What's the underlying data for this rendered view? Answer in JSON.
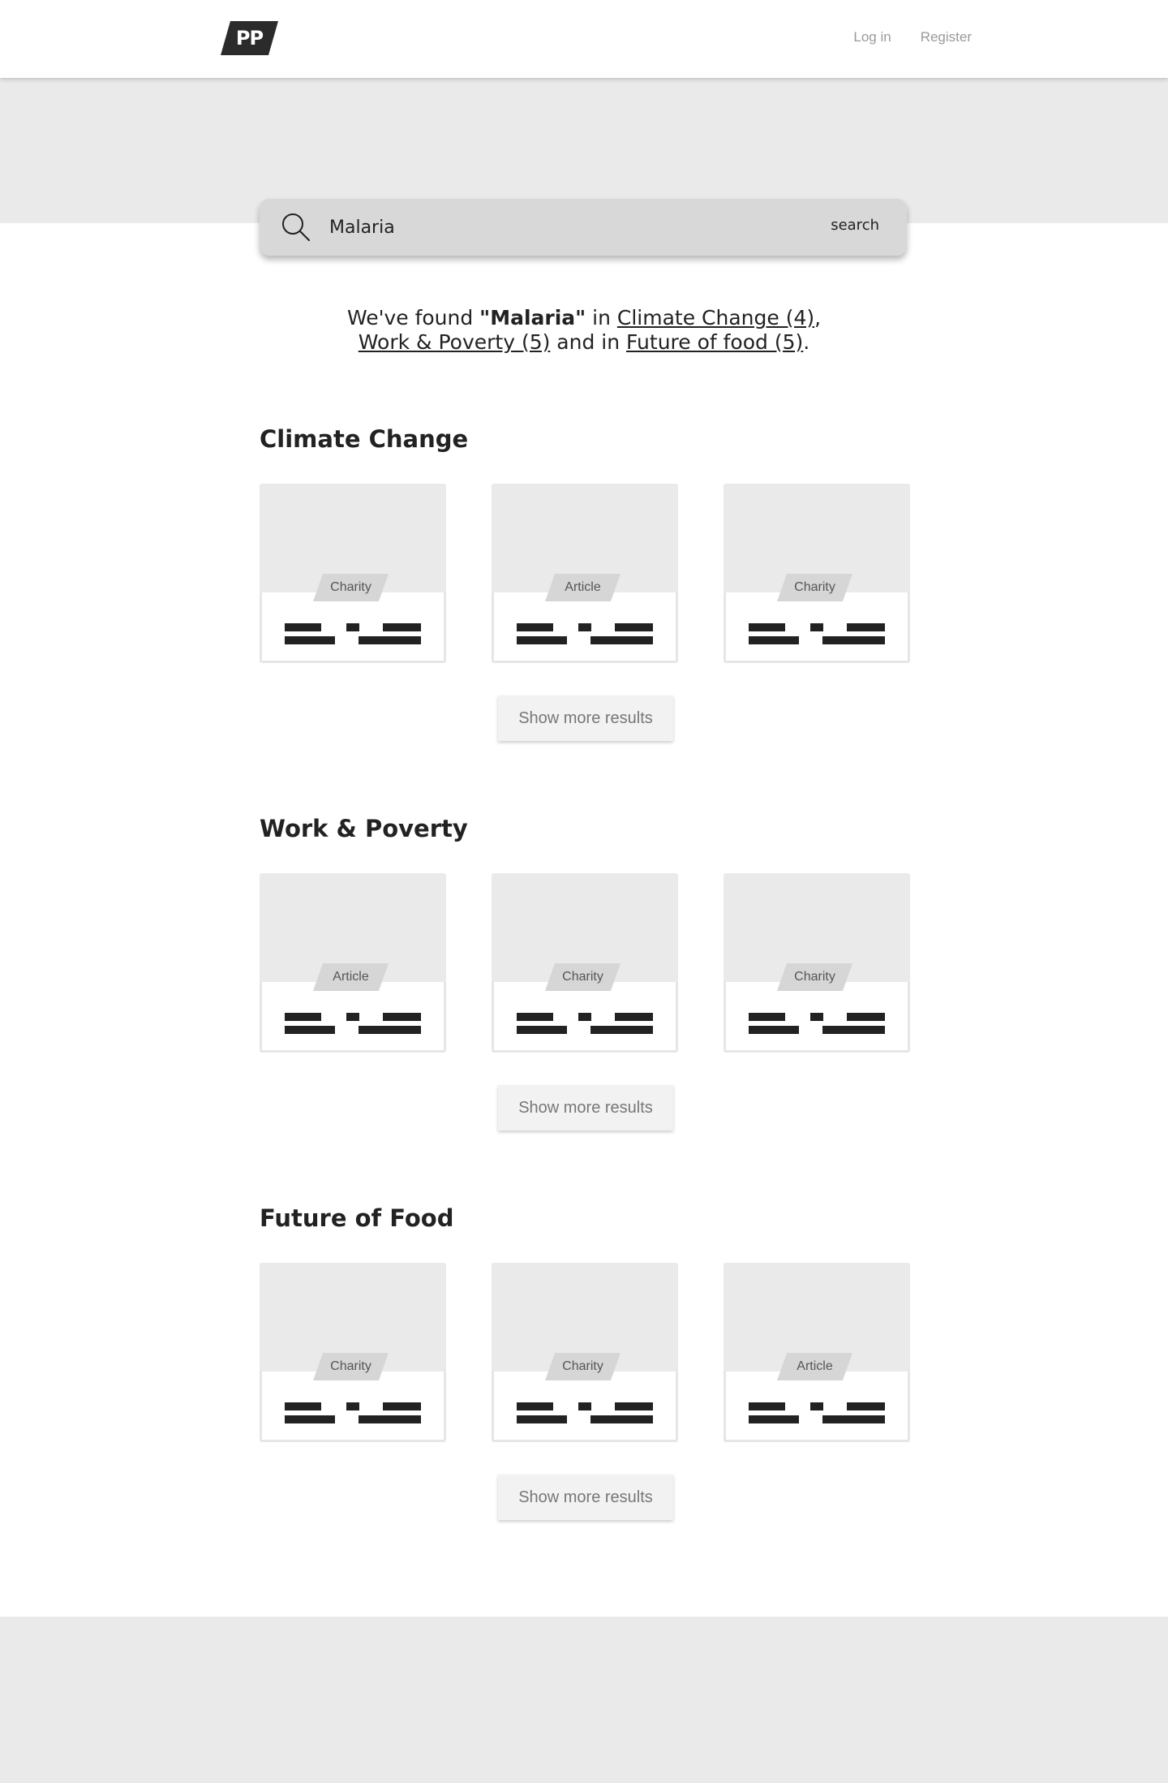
{
  "header": {
    "logo_text": "PP",
    "nav": {
      "login": "Log in",
      "register": "Register"
    }
  },
  "search": {
    "value": "Malaria",
    "button_label": "search"
  },
  "summary": {
    "prefix": "We've found ",
    "query": "\"Malaria\"",
    "in1": " in ",
    "link1": "Climate Change (4)",
    "sep": ",",
    "link2": "Work & Poverty (5)",
    "in2": " and in ",
    "link3": "Future of food (5)",
    "end": "."
  },
  "sections": [
    {
      "title": "Climate Change",
      "cards": [
        {
          "tag": "Charity"
        },
        {
          "tag": "Article"
        },
        {
          "tag": "Charity"
        }
      ],
      "more_label": "Show more results"
    },
    {
      "title": "Work & Poverty",
      "cards": [
        {
          "tag": "Article"
        },
        {
          "tag": "Charity"
        },
        {
          "tag": "Charity"
        }
      ],
      "more_label": "Show more results"
    },
    {
      "title": "Future of Food",
      "cards": [
        {
          "tag": "Charity"
        },
        {
          "tag": "Charity"
        },
        {
          "tag": "Article"
        }
      ],
      "more_label": "Show more results"
    }
  ],
  "colors": {
    "band_gray": "#eaeaea",
    "search_bar": "#d8d8d8",
    "text_dark": "#222222",
    "tag_gray": "#d6d6d6"
  }
}
